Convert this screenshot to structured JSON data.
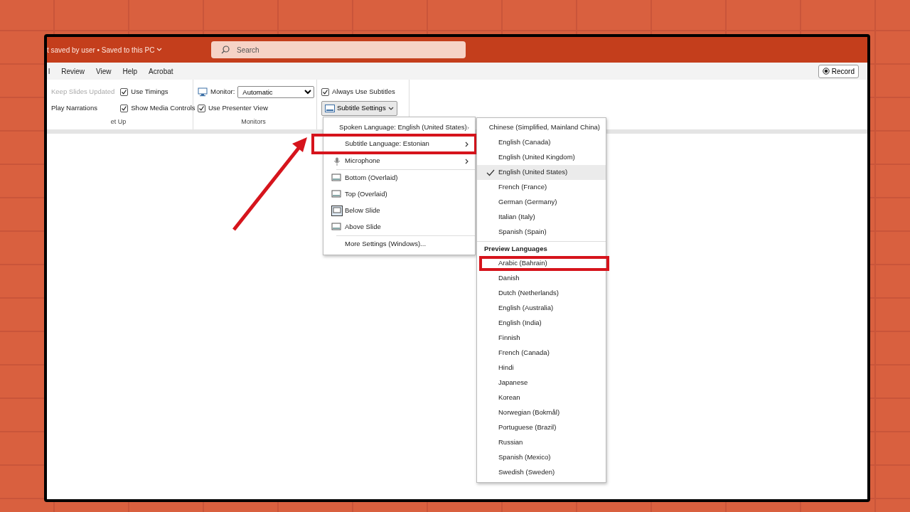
{
  "title_bar": {
    "file_status": "t saved by user • Saved to this PC",
    "search": {
      "placeholder": "Search"
    }
  },
  "ribbon_tabs": [
    {
      "label": "l"
    },
    {
      "label": "Review"
    },
    {
      "label": "View"
    },
    {
      "label": "Help"
    },
    {
      "label": "Acrobat"
    }
  ],
  "record_button": {
    "label": "Record"
  },
  "ribbon_groups": [
    {
      "label": "et Up",
      "controls": [
        {
          "kind": "text",
          "label": "Keep Slides Updated",
          "disabled": true
        },
        {
          "kind": "text",
          "label": "Play Narrations",
          "disabled": false
        },
        {
          "kind": "checkbox",
          "label": "Use Timings",
          "checked": true
        },
        {
          "kind": "checkbox",
          "label": "Show Media Controls",
          "checked": true
        }
      ]
    },
    {
      "label": "Monitors",
      "controls": [
        {
          "kind": "select",
          "label": "Monitor:",
          "value": "Automatic"
        },
        {
          "kind": "checkbox",
          "label": "Use Presenter View",
          "checked": true
        }
      ]
    },
    {
      "controls": [
        {
          "kind": "checkbox",
          "label": "Always Use Subtitles",
          "checked": true
        },
        {
          "kind": "menu_button",
          "label": "Subtitle Settings",
          "expanded": true
        }
      ]
    }
  ],
  "subtitle_menu": {
    "items": [
      {
        "kind": "submenu",
        "label": "Spoken Language: English (United States)",
        "callout": false
      },
      {
        "kind": "submenu",
        "label": "Subtitle Language: Estonian",
        "callout": true
      },
      {
        "kind": "device",
        "label": "Microphone",
        "callout": false
      },
      {
        "kind": "position",
        "label": "Bottom (Overlaid)",
        "selected": false
      },
      {
        "kind": "position",
        "label": "Top (Overlaid)",
        "selected": false
      },
      {
        "kind": "position",
        "label": "Below Slide",
        "selected": true
      },
      {
        "kind": "position",
        "label": "Above Slide",
        "selected": false
      },
      {
        "kind": "command",
        "label": "More Settings (Windows)..."
      }
    ]
  },
  "language_menu": {
    "items": [
      {
        "kind": "language",
        "label": "Chinese (Simplified, Mainland China)",
        "checked": false,
        "callout": false
      },
      {
        "kind": "language",
        "label": "English (Canada)",
        "checked": false,
        "callout": false
      },
      {
        "kind": "language",
        "label": "English (United Kingdom)",
        "checked": false,
        "callout": false
      },
      {
        "kind": "language",
        "label": "English (United States)",
        "checked": true,
        "callout": false
      },
      {
        "kind": "language",
        "label": "French (France)",
        "checked": false,
        "callout": false
      },
      {
        "kind": "language",
        "label": "German (Germany)",
        "checked": false,
        "callout": false
      },
      {
        "kind": "language",
        "label": "Italian (Italy)",
        "checked": false,
        "callout": false
      },
      {
        "kind": "language",
        "label": "Spanish (Spain)",
        "checked": false,
        "callout": false
      },
      {
        "kind": "heading",
        "label": "Preview Languages"
      },
      {
        "kind": "language",
        "label": "Arabic (Bahrain)",
        "checked": false,
        "callout": true
      },
      {
        "kind": "language",
        "label": "Danish",
        "checked": false,
        "callout": false
      },
      {
        "kind": "language",
        "label": "Dutch (Netherlands)",
        "checked": false,
        "callout": false
      },
      {
        "kind": "language",
        "label": "English (Australia)",
        "checked": false,
        "callout": false
      },
      {
        "kind": "language",
        "label": "English (India)",
        "checked": false,
        "callout": false
      },
      {
        "kind": "language",
        "label": "Finnish",
        "checked": false,
        "callout": false
      },
      {
        "kind": "language",
        "label": "French (Canada)",
        "checked": false,
        "callout": false
      },
      {
        "kind": "language",
        "label": "Hindi",
        "checked": false,
        "callout": false
      },
      {
        "kind": "language",
        "label": "Japanese",
        "checked": false,
        "callout": false
      },
      {
        "kind": "language",
        "label": "Korean",
        "checked": false,
        "callout": false
      },
      {
        "kind": "language",
        "label": "Norwegian (Bokmål)",
        "checked": false,
        "callout": false
      },
      {
        "kind": "language",
        "label": "Portuguese (Brazil)",
        "checked": false,
        "callout": false
      },
      {
        "kind": "language",
        "label": "Russian",
        "checked": false,
        "callout": false
      },
      {
        "kind": "language",
        "label": "Spanish (Mexico)",
        "checked": false,
        "callout": false
      },
      {
        "kind": "language",
        "label": "Swedish (Sweden)",
        "checked": false,
        "callout": false
      }
    ]
  }
}
